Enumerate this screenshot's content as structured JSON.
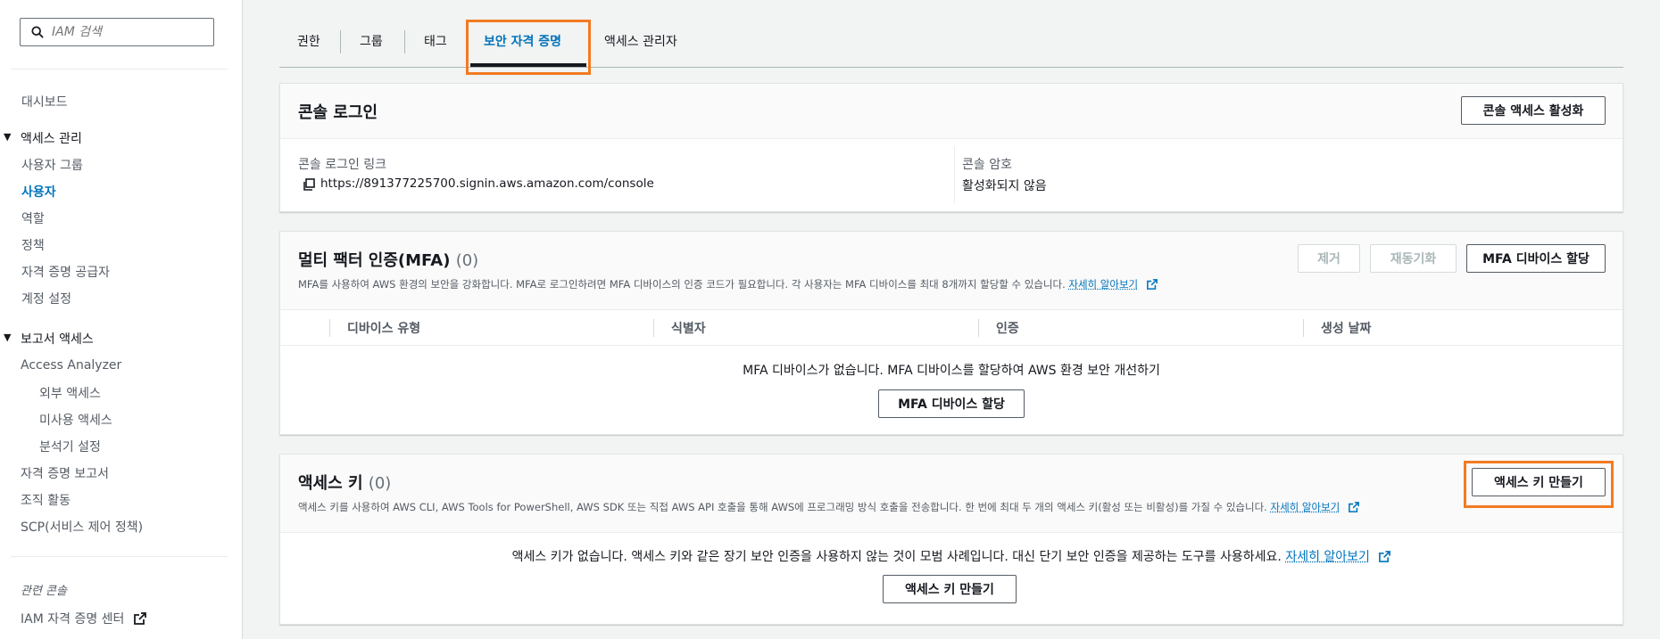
{
  "search": {
    "placeholder": "IAM 검색"
  },
  "sidebar": {
    "dashboard": "대시보드",
    "access_mgmt": "액세스 관리",
    "items_access": [
      "사용자 그룹",
      "사용자",
      "역할",
      "정책",
      "자격 증명 공급자",
      "계정 설정"
    ],
    "report_access": "보고서 액세스",
    "access_analyzer": "Access Analyzer",
    "analyzer_items": [
      "외부 액세스",
      "미사용 액세스",
      "분석기 설정"
    ],
    "items_report": [
      "자격 증명 보고서",
      "조직 활동",
      "SCP(서비스 제어 정책)"
    ],
    "related_console": "관련 콘솔",
    "iam_identity_center": "IAM 자격 증명 센터"
  },
  "tabs": [
    "권한",
    "그룹",
    "태그",
    "보안 자격 증명",
    "액세스 관리자"
  ],
  "console_login": {
    "title": "콘솔 로그인",
    "enable_button": "콘솔 액세스 활성화",
    "link_label": "콘솔 로그인 링크",
    "link_value": "https://891377225700.signin.aws.amazon.com/console",
    "password_label": "콘솔 암호",
    "password_value": "활성화되지 않음"
  },
  "mfa": {
    "title": "멀티 팩터 인증(MFA)",
    "count": "(0)",
    "description": "MFA를 사용하여 AWS 환경의 보안을 강화합니다. MFA로 로그인하려면 MFA 디바이스의 인증 코드가 필요합니다. 각 사용자는 MFA 디바이스를 최대 8개까지 할당할 수 있습니다.",
    "learn_more": "자세히 알아보기",
    "remove_button": "제거",
    "resync_button": "재동기화",
    "assign_button": "MFA 디바이스 할당",
    "columns": [
      "디바이스 유형",
      "식별자",
      "인증",
      "생성 날짜"
    ],
    "empty_text": "MFA 디바이스가 없습니다. MFA 디바이스를 할당하여 AWS 환경 보안 개선하기",
    "empty_button": "MFA 디바이스 할당"
  },
  "access_keys": {
    "title": "액세스 키",
    "count": "(0)",
    "description": "액세스 키를 사용하여 AWS CLI, AWS Tools for PowerShell, AWS SDK 또는 직접 AWS API 호출을 통해 AWS에 프로그래밍 방식 호출을 전송합니다. 한 번에 최대 두 개의 액세스 키(활성 또는 비활성)를 가질 수 있습니다.",
    "learn_more": "자세히 알아보기",
    "create_button": "액세스 키 만들기",
    "empty_text": "액세스 키가 없습니다. 액세스 키와 같은 장기 보안 인증을 사용하지 않는 것이 모범 사례입니다. 대신 단기 보안 인증을 제공하는 도구를 사용하세요.",
    "empty_learn_more": "자세히 알아보기",
    "empty_button": "액세스 키 만들기"
  },
  "colors": {
    "accent": "#0073bb",
    "highlight": "#f27b22"
  }
}
